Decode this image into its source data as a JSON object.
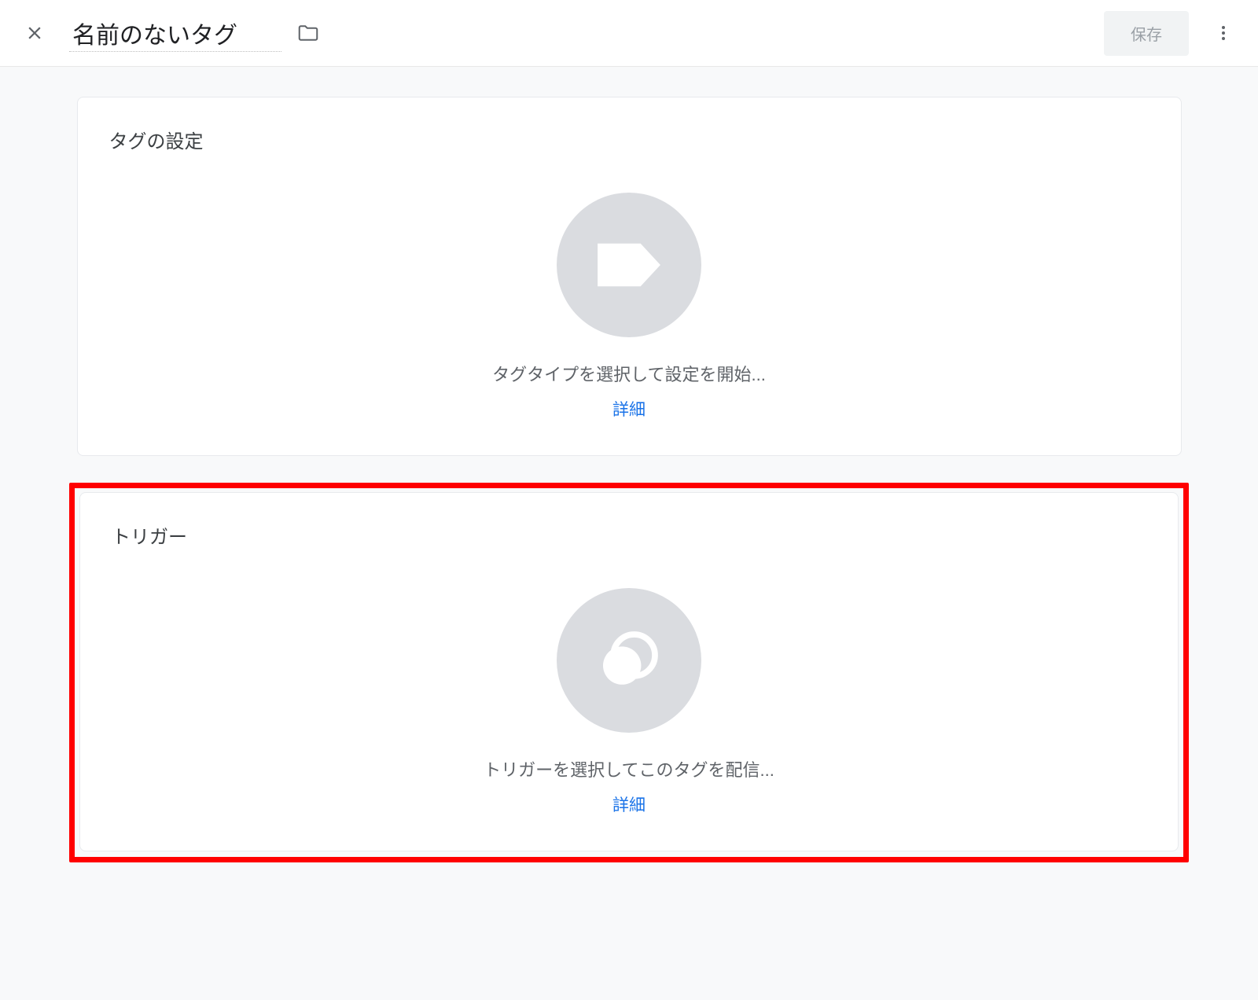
{
  "header": {
    "title": "名前のないタグ",
    "save_label": "保存"
  },
  "cards": {
    "tag_config": {
      "title": "タグの設定",
      "empty_text": "タグタイプを選択して設定を開始...",
      "detail_link": "詳細"
    },
    "trigger": {
      "title": "トリガー",
      "empty_text": "トリガーを選択してこのタグを配信...",
      "detail_link": "詳細"
    }
  }
}
